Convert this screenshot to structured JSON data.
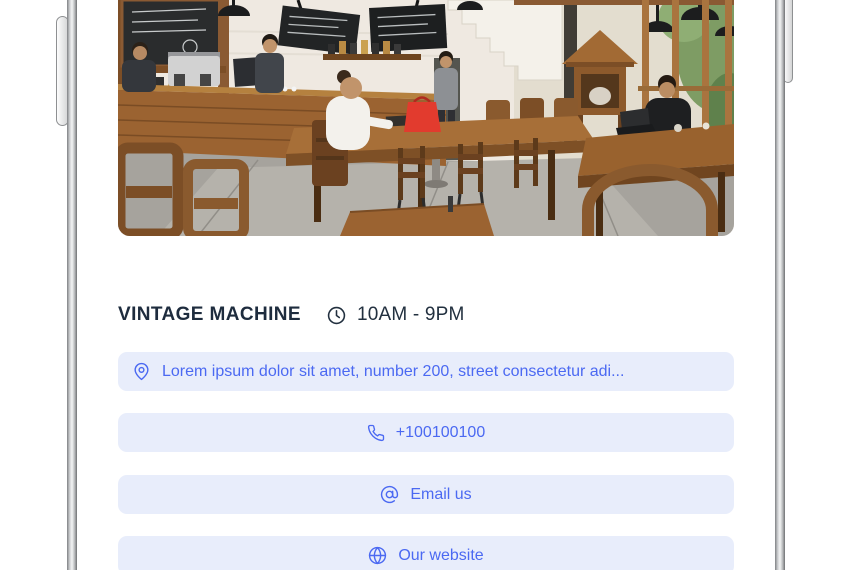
{
  "device": {
    "type": "phone-mockup",
    "frame_color": "#b9bbbd",
    "screen_color": "#ffffff"
  },
  "business": {
    "name": "VINTAGE MACHINE",
    "hours": "10AM - 9PM",
    "photo_alt": "Cafe interior with wooden bar counter, chalkboard menus, pendant lamps, wooden tables and chairs, staircase and large windows with greenery",
    "actions": [
      {
        "id": "address",
        "icon": "location-pin-icon",
        "label": "Lorem ipsum dolor sit amet, number 200, street consectetur adi...",
        "align": "left"
      },
      {
        "id": "phone",
        "icon": "phone-icon",
        "label": "+100100100",
        "align": "center"
      },
      {
        "id": "email",
        "icon": "at-icon",
        "label": "Email us",
        "align": "center"
      },
      {
        "id": "website",
        "icon": "globe-icon",
        "label": "Our website",
        "align": "center"
      }
    ]
  },
  "icons": [
    "clock-icon",
    "location-pin-icon",
    "phone-icon",
    "at-icon",
    "globe-icon"
  ],
  "colors": {
    "accent_blue": "#4b69f2",
    "pill_background": "#e8edfb",
    "title_text": "#1e2c3e",
    "page_background": "#ffffff"
  }
}
